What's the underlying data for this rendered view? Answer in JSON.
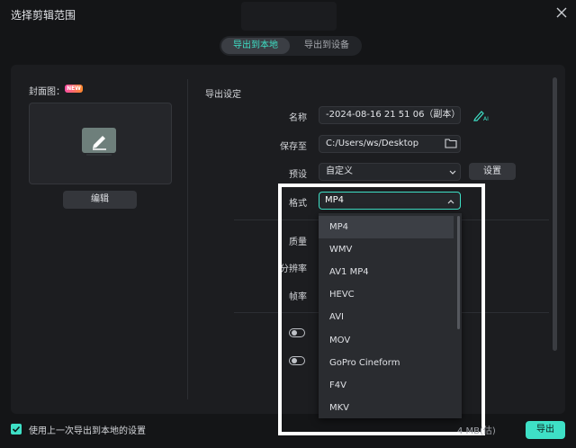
{
  "window": {
    "title": "选择剪辑范围"
  },
  "tabs": [
    {
      "label": "导出到本地",
      "active": true
    },
    {
      "label": "导出到设备",
      "active": false
    }
  ],
  "cover": {
    "label": "封面图：",
    "badge": "NEW",
    "edit_button": "编辑"
  },
  "export_settings": {
    "section_title": "导出设定",
    "name": {
      "label": "名称",
      "value": "-2024-08-16 21 51 06（副本）"
    },
    "save_to": {
      "label": "保存至",
      "value": "C:/Users/ws/Desktop"
    },
    "preset": {
      "label": "预设",
      "value": "自定义",
      "settings_button": "设置"
    },
    "format": {
      "label": "格式",
      "value": "MP4"
    },
    "quality": {
      "label": "质量"
    },
    "resolution": {
      "label": "分辨率"
    },
    "framerate": {
      "label": "帧率"
    }
  },
  "format_dropdown": {
    "options": [
      "MP4",
      "WMV",
      "AV1 MP4",
      "HEVC",
      "AVI",
      "MOV",
      "GoPro Cineform",
      "F4V",
      "MKV"
    ],
    "selected": "MP4"
  },
  "footer": {
    "use_last_settings_label": "使用上一次导出到本地的设置",
    "use_last_settings_checked": true,
    "size_text": "4 MB(估)",
    "export_button": "导出"
  },
  "colors": {
    "accent": "#3ee0c6",
    "background": "#141517",
    "panel": "#1c1d20",
    "highlight_frame": "#ffffff"
  },
  "icons": [
    "close-icon",
    "pencil-icon",
    "ai-pen-icon",
    "folder-icon",
    "chevron-down-icon",
    "chevron-up-icon",
    "checkbox-icon"
  ]
}
